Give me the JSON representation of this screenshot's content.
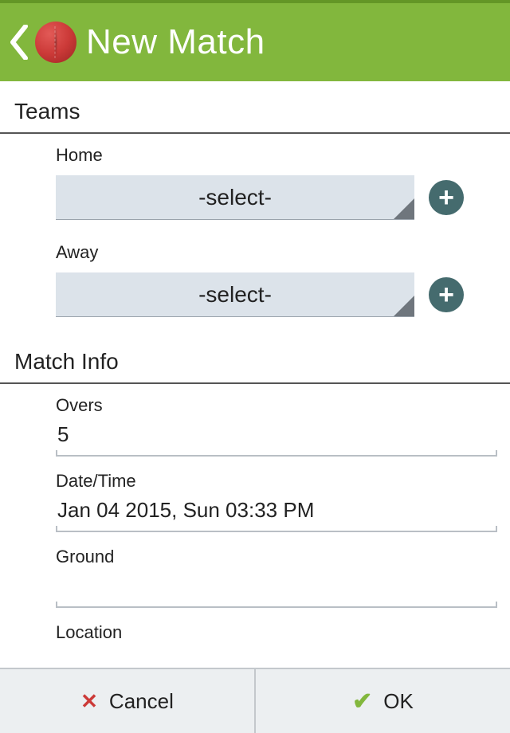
{
  "header": {
    "title": "New Match"
  },
  "sections": {
    "teams": {
      "heading": "Teams",
      "home_label": "Home",
      "home_value": "-select-",
      "away_label": "Away",
      "away_value": "-select-"
    },
    "match_info": {
      "heading": "Match Info",
      "overs_label": "Overs",
      "overs_value": "5",
      "datetime_label": "Date/Time",
      "datetime_value": "Jan 04 2015, Sun 03:33 PM",
      "ground_label": "Ground",
      "ground_value": "",
      "location_label": "Location",
      "location_value": ""
    }
  },
  "footer": {
    "cancel_label": "Cancel",
    "ok_label": "OK"
  }
}
